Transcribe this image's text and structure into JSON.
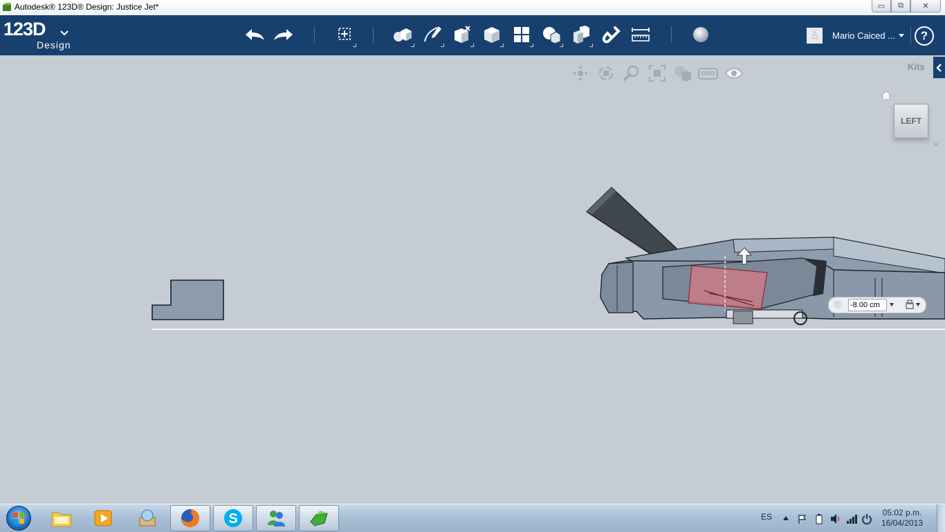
{
  "window": {
    "title": "Autodesk® 123D® Design: Justice Jet*",
    "controls": {
      "minimize": "▭",
      "maximize": "⧉",
      "close": "✕"
    }
  },
  "app": {
    "logo_main": "123D",
    "logo_sub": "Design",
    "toolbar": [
      "undo-icon",
      "redo-icon",
      "transform-icon",
      "primitives-icon",
      "sketch-icon",
      "construct-icon",
      "modify-icon",
      "pattern-icon",
      "grouping-icon",
      "combine-icon",
      "snap-icon",
      "measure-icon",
      "material-icon"
    ],
    "user": {
      "name": "Mario Caiced ...",
      "avatar_glyph": "♙"
    },
    "help": "?"
  },
  "viewport": {
    "kits_label": "Kits",
    "viewcube_face": "LEFT",
    "nav_tools": [
      "pan-icon",
      "orbit-icon",
      "zoom-icon",
      "fit-icon",
      "view-mode-icon",
      "units-icon",
      "visibility-icon"
    ],
    "units_label": "mm",
    "dimension_value": "-8.00 cm"
  },
  "taskbar": {
    "apps": [
      "explorer",
      "media-player",
      "sandbox",
      "firefox",
      "skype",
      "messenger",
      "123d-design"
    ],
    "active_app": "123d-design",
    "language": "ES",
    "time": "05:02 p.m.",
    "date": "16/04/2013"
  },
  "colors": {
    "appbar": "#17406f",
    "viewport_bg": "#c6ccd4",
    "model": "#8d9cad",
    "selection": "#d77a84"
  }
}
